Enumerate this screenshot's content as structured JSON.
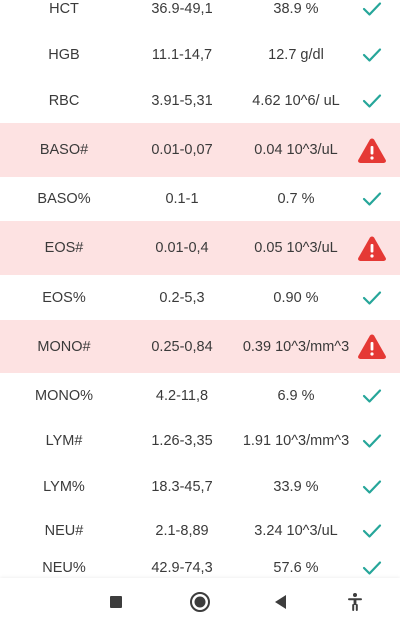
{
  "rows": [
    {
      "name": "HCT",
      "range": "36.9-49,1",
      "value": "38.9 %",
      "status": "ok"
    },
    {
      "name": "HGB",
      "range": "11.1-14,7",
      "value": "12.7 g/dl",
      "status": "ok"
    },
    {
      "name": "RBC",
      "range": "3.91-5,31",
      "value": "4.62 10^6/ uL",
      "status": "ok"
    },
    {
      "name": "BASO#",
      "range": "0.01-0,07",
      "value": "0.04 10^3/uL",
      "status": "warning"
    },
    {
      "name": "BASO%",
      "range": "0.1-1",
      "value": "0.7 %",
      "status": "ok"
    },
    {
      "name": "EOS#",
      "range": "0.01-0,4",
      "value": "0.05 10^3/uL",
      "status": "warning"
    },
    {
      "name": "EOS%",
      "range": "0.2-5,3",
      "value": "0.90 %",
      "status": "ok"
    },
    {
      "name": "MONO#",
      "range": "0.25-0,84",
      "value": "0.39 10^3/mm^3",
      "status": "warning"
    },
    {
      "name": "MONO%",
      "range": "4.2-11,8",
      "value": "6.9 %",
      "status": "ok"
    },
    {
      "name": "LYM#",
      "range": "1.26-3,35",
      "value": "1.91 10^3/mm^3",
      "status": "ok"
    },
    {
      "name": "LYM%",
      "range": "18.3-45,7",
      "value": "33.9 %",
      "status": "ok"
    },
    {
      "name": "NEU#",
      "range": "2.1-8,89",
      "value": "3.24 10^3/uL",
      "status": "ok"
    },
    {
      "name": "NEU%",
      "range": "42.9-74,3",
      "value": "57.6 %",
      "status": "ok"
    }
  ],
  "icons": {
    "ok": "check-icon",
    "warning": "warning-triangle-icon",
    "nav_recents": "square-icon",
    "nav_home": "circle-icon",
    "nav_back": "back-triangle-icon",
    "nav_accessibility": "accessibility-icon"
  },
  "colors": {
    "ok_check": "#26a69a",
    "warning_red": "#e53935",
    "flag_row_bg": "#fde2e2"
  }
}
